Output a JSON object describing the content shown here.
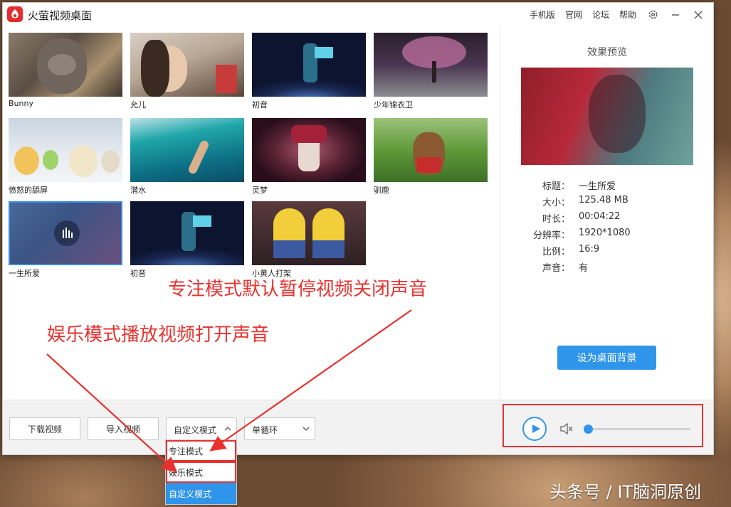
{
  "window": {
    "title": "火萤视频桌面",
    "links": [
      "手机版",
      "官网",
      "论坛",
      "帮助"
    ]
  },
  "icons": {
    "logo": "firefly-logo-icon",
    "settings": "gear-icon",
    "minimize": "minimize-icon",
    "close": "close-icon"
  },
  "gallery": {
    "items": [
      {
        "label": "Bunny"
      },
      {
        "label": "允儿"
      },
      {
        "label": "初音"
      },
      {
        "label": "少年锦衣卫"
      },
      {
        "label": "愤怒的舔屏"
      },
      {
        "label": "潜水"
      },
      {
        "label": "灵梦"
      },
      {
        "label": "驯鹿"
      },
      {
        "label": "一生所爱",
        "selected": true
      },
      {
        "label": "初音"
      },
      {
        "label": "小黄人打架"
      }
    ]
  },
  "preview": {
    "heading": "效果预览",
    "info": [
      {
        "key": "标题：",
        "value": "一生所爱"
      },
      {
        "key": "大小：",
        "value": "125.48 MB"
      },
      {
        "key": "时长：",
        "value": "00:04:22"
      },
      {
        "key": "分辨率：",
        "value": "1920*1080"
      },
      {
        "key": "比例：",
        "value": "16:9"
      },
      {
        "key": "声音：",
        "value": "有"
      }
    ],
    "set_background_label": "设为桌面背景"
  },
  "toolbar": {
    "download_label": "下载视频",
    "import_label": "导入视频",
    "mode_value": "自定义模式",
    "loop_value": "单循环"
  },
  "mode_menu": {
    "options": [
      "专注模式",
      "娱乐模式",
      "自定义模式"
    ],
    "selected": "自定义模式"
  },
  "player": {
    "volume_fraction": 0.0
  },
  "annotations": {
    "focus_note": "专注模式默认暂停视频关闭声音",
    "entertain_note": "娱乐模式播放视频打开声音"
  },
  "watermark": "头条号 / IT脑洞原创",
  "colors": {
    "accent": "#2f95ea",
    "annotation_red": "#e33232",
    "logo_red": "#e52b2b"
  }
}
